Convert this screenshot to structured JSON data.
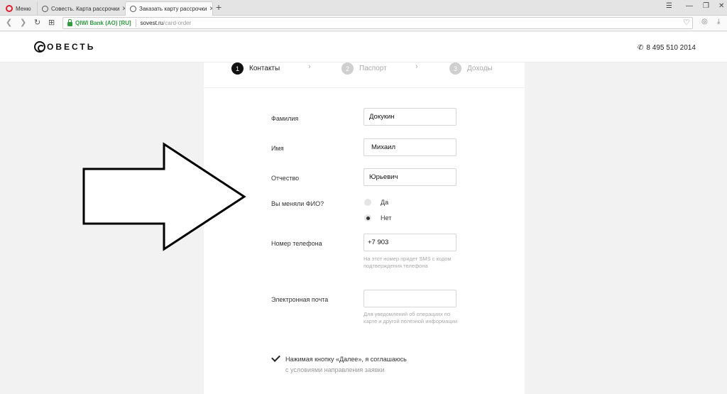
{
  "browser": {
    "tabs": [
      {
        "label": "Меню"
      },
      {
        "label": "Совесть. Карта рассрочки"
      },
      {
        "label": "Заказать карту рассрочки"
      }
    ],
    "address": {
      "security_label": "QIWI Bank (AO) [RU]",
      "host": "sovest.ru",
      "path": "/card-order"
    }
  },
  "site": {
    "logo_text": "ОВЕСТЬ",
    "phone": "8 495 510 2014"
  },
  "steps": [
    {
      "num": "1",
      "label": "Контакты",
      "active": true
    },
    {
      "num": "2",
      "label": "Паспорт",
      "active": false
    },
    {
      "num": "3",
      "label": "Доходы",
      "active": false
    }
  ],
  "form": {
    "last_name": {
      "label": "Фамилия",
      "value": "Докукин"
    },
    "first_name": {
      "label": "Имя",
      "value": "Михаил"
    },
    "patronymic": {
      "label": "Отчество",
      "value": "Юрьевич"
    },
    "name_changed": {
      "label": "Вы меняли ФИО?",
      "options": [
        "Да",
        "Нет"
      ],
      "selected": "Нет"
    },
    "phone": {
      "label": "Номер телефона",
      "value": "+7 903 ",
      "hint": "На этот номер придет SMS с кодом подтверждения телефона"
    },
    "email": {
      "label": "Электронная почта",
      "value": "",
      "hint": "Для уведомлений об операциях по карте и другой полезной информации"
    },
    "agree": {
      "text": "Нажимая кнопку «Далее», я соглашаюсь",
      "subtext": "с условиями направления заявки"
    }
  }
}
